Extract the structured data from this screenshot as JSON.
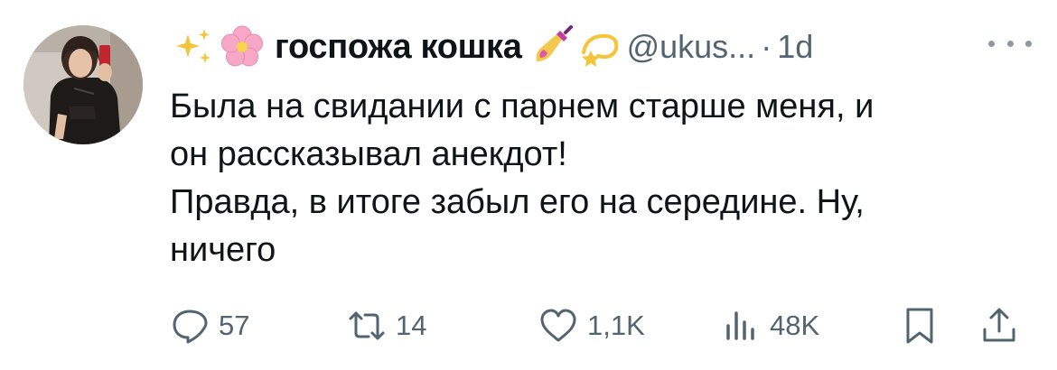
{
  "tweet": {
    "author": {
      "display_name": "госпожа кошка",
      "handle": "@ukus...",
      "separator": "·",
      "time": "1d",
      "name_prefix_emoji": [
        "sparkles-emoji",
        "cherry-blossom-emoji"
      ],
      "name_suffix_emoji": [
        "nail-polish-emoji",
        "dizzy-emoji"
      ]
    },
    "text_lines": [
      "Была на свидании с парнем старше меня, и",
      "он рассказывал анекдот!",
      "Правда, в итоге забыл его на середине. Ну,",
      "ничего"
    ],
    "actions": {
      "replies": "57",
      "retweets": "14",
      "likes": "1,1K",
      "views": "48K"
    },
    "colors": {
      "text": "#0f1419",
      "secondary": "#536471",
      "background": "#ffffff"
    }
  }
}
